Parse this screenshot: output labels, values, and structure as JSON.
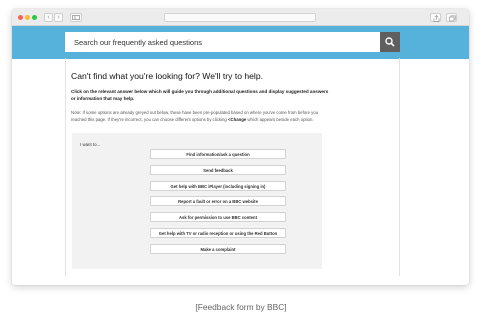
{
  "browser": {
    "nav": {
      "back": "‹",
      "forward": "›"
    }
  },
  "search": {
    "placeholder": "Search our frequently asked questions",
    "button_icon": "search-icon"
  },
  "content": {
    "title": "Can't find what you're looking for? We'll try to help.",
    "instructions": "Click on the relevant answer below which will guide you through additional questions and display suggested answers or information that may help.",
    "note_prefix": "Note: If some options are already greyed out below, these have been pre-populated based on where you've come from before you reached this page. If they're incorrect, you can choose different options by clicking ",
    "note_link": "<Change",
    "note_suffix": " which appears beside each option."
  },
  "form": {
    "label": "I want to...",
    "options": [
      "Find information/ask a question",
      "Send feedback",
      "Get help with BBC iPlayer (including signing in)",
      "Report a fault or error on a BBC website",
      "Ask for permission to use BBC content",
      "Get help with TV or radio reception or using the Red Button",
      "Make a complaint"
    ]
  },
  "caption": "[Feedback form by BBC]"
}
